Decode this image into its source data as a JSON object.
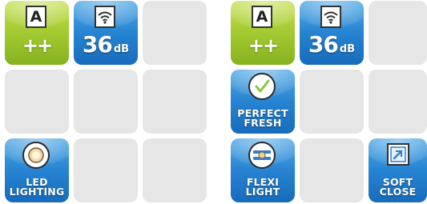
{
  "panels": [
    {
      "energy": {
        "letter": "A",
        "rating": "++"
      },
      "noise": {
        "value": "36",
        "unit": "dB"
      },
      "features": [
        {
          "line1": "LED",
          "line2": "LIGHTING",
          "icon": "led-light-icon"
        }
      ]
    },
    {
      "energy": {
        "letter": "A",
        "rating": "++"
      },
      "noise": {
        "value": "36",
        "unit": "dB"
      },
      "features": [
        {
          "line1": "PERFECT",
          "line2": "FRESH",
          "icon": "checkmark-icon"
        },
        {
          "line1": "FLEXI",
          "line2": "LIGHT",
          "icon": "flexi-light-icon"
        },
        {
          "line1": "SOFT",
          "line2": "CLOSE",
          "icon": "soft-close-icon"
        }
      ]
    }
  ],
  "colors": {
    "green": "#a6cc32",
    "blue": "#2684d2",
    "empty": "#e6e6e6"
  }
}
